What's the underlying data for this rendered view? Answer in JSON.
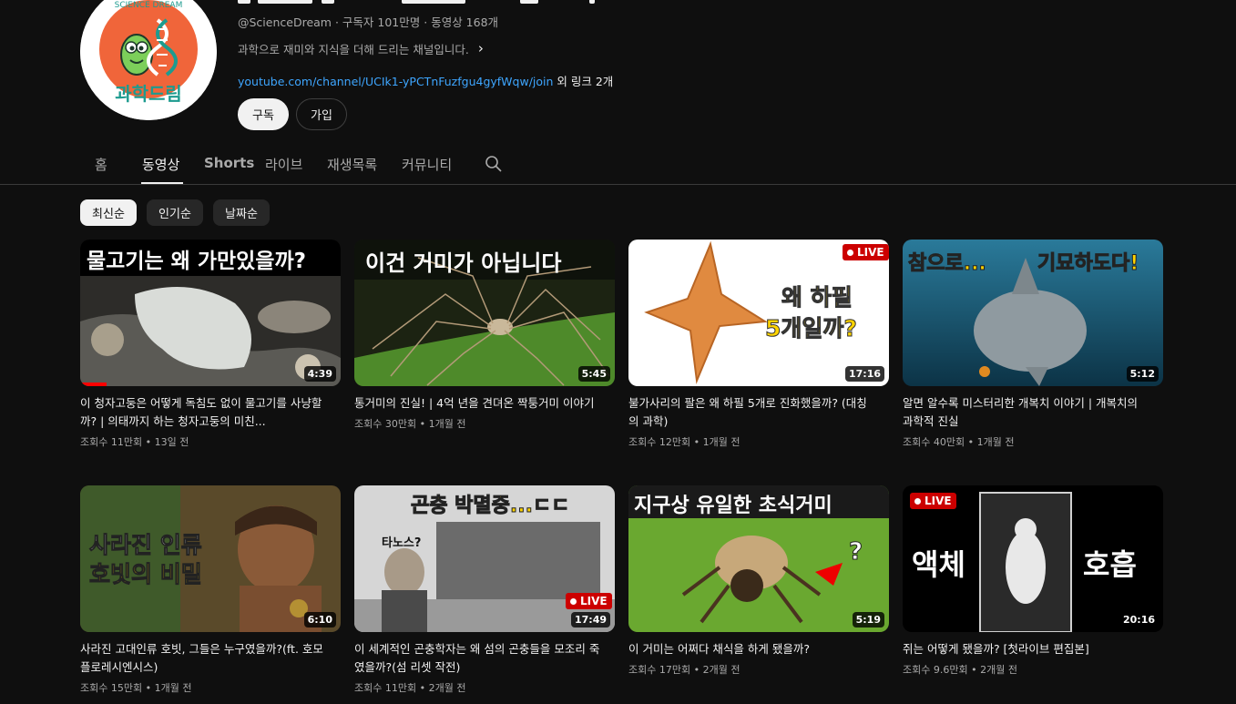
{
  "channel": {
    "handle": "@ScienceDream",
    "subscribers": "구독자 101만명",
    "video_count": "동영상 168개",
    "description": "과학으로 재미와 지식을 더해 드리는 채널입니다.",
    "link_url": "youtube.com/channel/UCIk1-yPCTnFuzfgu4gyfWqw/join",
    "link_more": "외 링크 2개",
    "subscribe_label": "구독",
    "join_label": "가입",
    "avatar_ring_text": "SCIENCE DREAM",
    "avatar_logo_text": "과학드림"
  },
  "tabs": [
    "홈",
    "동영상",
    "Shorts",
    "라이브",
    "재생목록",
    "커뮤니티"
  ],
  "active_tab": "동영상",
  "chips": [
    "최신순",
    "인기순",
    "날짜순"
  ],
  "active_chip": "최신순",
  "icons": {
    "search": "search-icon",
    "chevron": "chevron-right-icon",
    "live_dot": "live-dot-icon"
  },
  "colors": {
    "background": "#0f0f0f",
    "link": "#3ea6ff",
    "live_badge": "#cc0000",
    "progress": "#ff0000",
    "thumb_caption_yellow": "#ffd400"
  },
  "videos": [
    {
      "title": "이 청자고둥은 어떻게 독침도 없이 물고기를 사냥할까? | 의태까지 하는 청자고둥의 미친...",
      "views": "조회수 11만회",
      "age": "13일 전",
      "duration": "4:39",
      "live": false,
      "watched_fraction": 0.1,
      "thumb_text": [
        "물고기는 왜 가만있을까?"
      ]
    },
    {
      "title": "통거미의 진실! | 4억 년을 견뎌온 짝퉁거미 이야기",
      "views": "조회수 30만회",
      "age": "1개월 전",
      "duration": "5:45",
      "live": false,
      "thumb_text": [
        "이건 거미가 아닙니다"
      ]
    },
    {
      "title": "불가사리의 팔은 왜 하필 5개로 진화했을까? (대칭의 과학)",
      "views": "조회수 12만회",
      "age": "1개월 전",
      "duration": "17:16",
      "live": true,
      "thumb_text": [
        "왜 하필",
        "5개일까?"
      ]
    },
    {
      "title": "알면 알수록 미스터리한 개복치 이야기 | 개복치의 과학적 진실",
      "views": "조회수 40만회",
      "age": "1개월 전",
      "duration": "5:12",
      "live": false,
      "thumb_text": [
        "참으로...",
        "기묘하도다!"
      ]
    },
    {
      "title": "사라진 고대인류 호빗, 그들은 누구였을까?(ft. 호모 플로레시엔시스)",
      "views": "조회수 15만회",
      "age": "1개월 전",
      "duration": "6:10",
      "live": false,
      "thumb_text": [
        "사라진 인류",
        "호빗의 비밀"
      ]
    },
    {
      "title": "이 세계적인 곤충학자는 왜 섬의 곤충들을 모조리 죽였을까?(섬 리셋 작전)",
      "views": "조회수 11만회",
      "age": "2개월 전",
      "duration": "17:49",
      "live": true,
      "thumb_text": [
        "곤충 박멸중...ㄷㄷ",
        "타노스?"
      ]
    },
    {
      "title": "이 거미는 어쩌다 채식을 하게 됐을까?",
      "views": "조회수 17만회",
      "age": "2개월 전",
      "duration": "5:19",
      "live": false,
      "thumb_text": [
        "지구상 유일한 초식거미",
        "?"
      ]
    },
    {
      "title": "쥐는 어떻게 됐을까? [첫라이브 편집본]",
      "views": "조회수 9.6만회",
      "age": "2개월 전",
      "duration": "20:16",
      "live": true,
      "thumb_text": [
        "액체",
        "호흡"
      ]
    }
  ],
  "live_label": "LIVE",
  "dot_separator": "•"
}
